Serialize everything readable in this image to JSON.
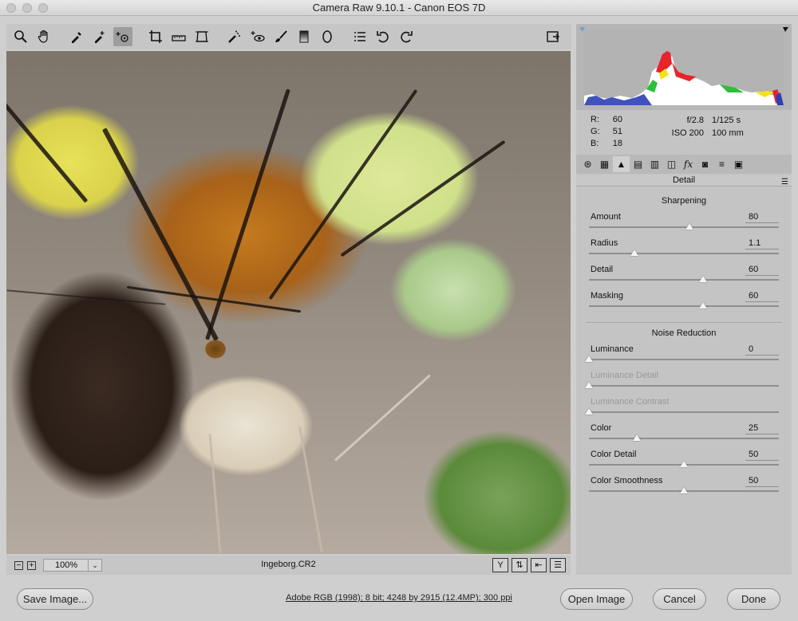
{
  "window": {
    "title": "Camera Raw 9.10.1  -  Canon EOS 7D"
  },
  "toolbar": {
    "tools": [
      "zoom-icon",
      "hand-icon",
      "white-balance-icon",
      "color-sampler-icon",
      "targeted-adjustment-icon",
      "crop-icon",
      "straighten-icon",
      "transform-icon",
      "spot-removal-icon",
      "red-eye-icon",
      "adjustment-brush-icon",
      "graduated-filter-icon",
      "radial-filter-icon",
      "preferences-icon",
      "rotate-left-icon",
      "rotate-right-icon"
    ],
    "active_tool": "targeted-adjustment-icon"
  },
  "status": {
    "zoom_level": "100%",
    "filename": "Ingeborg.CR2"
  },
  "readouts": {
    "r_label": "R:",
    "r_value": "60",
    "g_label": "G:",
    "g_value": "51",
    "b_label": "B:",
    "b_value": "18",
    "aperture": "f/2.8",
    "shutter": "1/125 s",
    "iso": "ISO 200",
    "focal_length": "100 mm"
  },
  "panel": {
    "title": "Detail",
    "sharpening_title": "Sharpening",
    "noise_title": "Noise Reduction",
    "sharpening": [
      {
        "label": "Amount",
        "value": "80",
        "fraction": 0.53
      },
      {
        "label": "Radius",
        "value": "1.1",
        "fraction": 0.24
      },
      {
        "label": "Detail",
        "value": "60",
        "fraction": 0.6
      },
      {
        "label": "Masking",
        "value": "60",
        "fraction": 0.6
      }
    ],
    "noise": [
      {
        "label": "Luminance",
        "value": "0",
        "fraction": 0.0,
        "disabled": false
      },
      {
        "label": "Luminance Detail",
        "value": "",
        "fraction": 0.0,
        "disabled": true
      },
      {
        "label": "Luminance Contrast",
        "value": "",
        "fraction": 0.0,
        "disabled": true
      },
      {
        "label": "Color",
        "value": "25",
        "fraction": 0.25,
        "disabled": false
      },
      {
        "label": "Color Detail",
        "value": "50",
        "fraction": 0.5,
        "disabled": false
      },
      {
        "label": "Color Smoothness",
        "value": "50",
        "fraction": 0.5,
        "disabled": false
      }
    ]
  },
  "footer": {
    "save_label": "Save Image...",
    "workflow_info": "Adobe RGB (1998); 8 bit; 4248 by 2915 (12.4MP); 300 ppi",
    "open_label": "Open Image",
    "cancel_label": "Cancel",
    "done_label": "Done"
  }
}
